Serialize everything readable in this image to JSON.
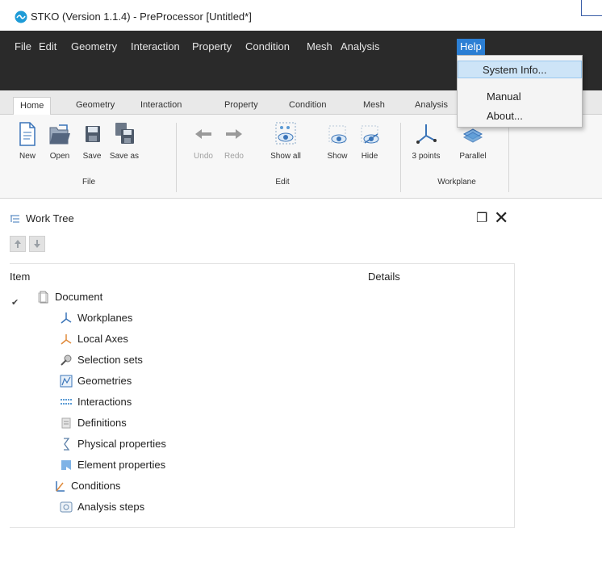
{
  "window": {
    "title": "STKO (Version 1.1.4) - PreProcessor [Untitled*]"
  },
  "menubar": {
    "items": [
      "File",
      "Edit",
      "Geometry",
      "Interaction",
      "Property",
      "Condition",
      "Mesh",
      "Analysis",
      "Help"
    ],
    "active": "Help"
  },
  "help_menu": {
    "items": [
      "System Info...",
      "Manual",
      "About..."
    ],
    "highlighted": "System Info..."
  },
  "tabs": {
    "items": [
      "Home",
      "Geometry",
      "Interaction",
      "Property",
      "Condition",
      "Mesh",
      "Analysis"
    ],
    "active": "Home"
  },
  "ribbon": {
    "file": {
      "label": "File",
      "buttons": [
        "New",
        "Open",
        "Save",
        "Save as"
      ]
    },
    "edit": {
      "label": "Edit",
      "buttons": [
        "Undo",
        "Redo",
        "Show all",
        "Show",
        "Hide"
      ]
    },
    "workplane": {
      "label": "Workplane",
      "buttons": [
        "3 points",
        "Parallel"
      ]
    }
  },
  "work_tree": {
    "title": "Work Tree",
    "columns": {
      "item": "Item",
      "details": "Details"
    },
    "root": "Document",
    "children": [
      "Workplanes",
      "Local Axes",
      "Selection sets",
      "Geometries",
      "Interactions",
      "Definitions",
      "Physical properties",
      "Element properties",
      "Conditions",
      "Analysis steps"
    ]
  },
  "colors": {
    "menubar_bg": "#2a2a2a",
    "menu_active": "#2c7fd4",
    "dropdown_highlight": "#cde4f7"
  }
}
